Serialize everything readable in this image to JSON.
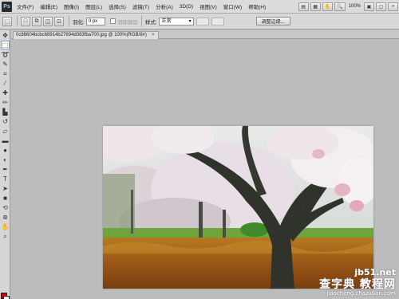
{
  "app": {
    "logo": "Ps"
  },
  "menu": {
    "items": [
      "文件(F)",
      "编辑(E)",
      "图像(I)",
      "图层(L)",
      "选择(S)",
      "滤镜(T)",
      "分析(A)",
      "3D(D)",
      "视图(V)",
      "窗口(W)",
      "帮助(H)"
    ],
    "zoom": "100%"
  },
  "options": {
    "feather_label": "羽化:",
    "feather_value": "0 px",
    "antialias_label": "消除锯齿",
    "style_label": "样式:",
    "style_value": "正常",
    "refine_button": "调整边缘..."
  },
  "document": {
    "tab_title": "0c86604bcbc68914b27694d083fba700.jpg @ 100%(RGB/8#)"
  },
  "colors": {
    "foreground": "#d60000",
    "background": "#ffffff",
    "accent": "#7fa5d8"
  },
  "icons": [
    "marquee-icon",
    "move-icon",
    "lasso-icon",
    "quick-select-icon",
    "crop-icon",
    "eyedropper-icon",
    "healing-icon",
    "brush-icon",
    "stamp-icon",
    "history-brush-icon",
    "eraser-icon",
    "gradient-icon",
    "blur-icon",
    "dodge-icon",
    "pen-icon",
    "type-icon",
    "path-select-icon",
    "shape-icon",
    "3d-rotate-icon",
    "3d-orbit-icon",
    "hand-icon",
    "zoom-icon"
  ],
  "watermark": {
    "top": "jb51.net",
    "main": "查字典 教程网",
    "url": "jiaocheng.chazidian.com"
  }
}
